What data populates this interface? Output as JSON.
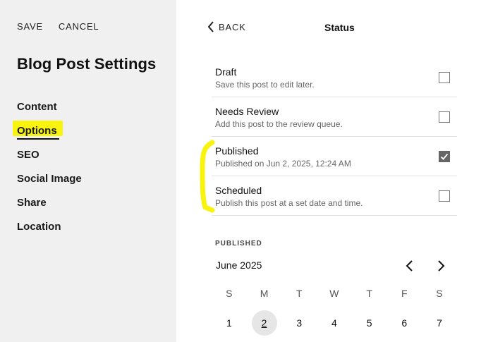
{
  "left": {
    "save_label": "SAVE",
    "cancel_label": "CANCEL",
    "title": "Blog Post Settings",
    "nav": [
      {
        "label": "Content"
      },
      {
        "label": "Options",
        "active": true
      },
      {
        "label": "SEO"
      },
      {
        "label": "Social Image"
      },
      {
        "label": "Share"
      },
      {
        "label": "Location"
      }
    ]
  },
  "right": {
    "back_label": "BACK",
    "title": "Status",
    "statuses": [
      {
        "name": "Draft",
        "description": "Save this post to edit later.",
        "checked": false
      },
      {
        "name": "Needs Review",
        "description": "Add this post to the review queue.",
        "checked": false
      },
      {
        "name": "Published",
        "description": "Published on Jun 2, 2025, 12:24 AM",
        "checked": true
      },
      {
        "name": "Scheduled",
        "description": "Publish this post at a set date and time.",
        "checked": false
      }
    ],
    "calendar": {
      "section_label": "PUBLISHED",
      "month": "June 2025",
      "weekdays": [
        "S",
        "M",
        "T",
        "W",
        "T",
        "F",
        "S"
      ],
      "days": [
        "1",
        "2",
        "3",
        "4",
        "5",
        "6",
        "7"
      ],
      "selected_day": "2"
    }
  },
  "colors": {
    "highlight": "#f8f40f",
    "checkbox_checked": "#666666"
  },
  "icons": {
    "back": "chevron-left-icon",
    "prev_month": "chevron-left-icon",
    "next_month": "chevron-right-icon",
    "check": "checkmark-icon"
  }
}
